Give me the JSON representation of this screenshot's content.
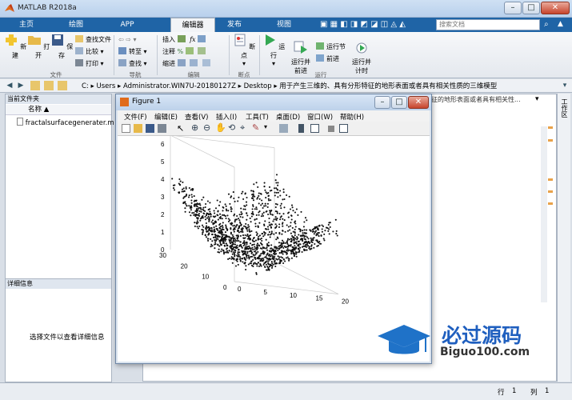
{
  "window": {
    "title": "MATLAB R2018a"
  },
  "tabs": [
    {
      "label": "主页",
      "active": false
    },
    {
      "label": "绘图",
      "active": false
    },
    {
      "label": "APP",
      "active": false
    },
    {
      "label": "编辑器",
      "active": true
    },
    {
      "label": "发布",
      "active": false
    },
    {
      "label": "视图",
      "active": false
    }
  ],
  "search": {
    "placeholder": "搜索文档"
  },
  "ribbon": {
    "file": {
      "new": "新建",
      "open": "打开",
      "save": "保存",
      "find_files": "查找文件",
      "compare": "比较",
      "print": "打印",
      "group": "文件"
    },
    "navigate": {
      "goto": "转至",
      "find": "查找",
      "group": "导航"
    },
    "edit": {
      "insert": "插入",
      "comment": "注释",
      "indent": "缩进",
      "group": "编辑"
    },
    "breakpoints": {
      "label": "断点",
      "group": "断点"
    },
    "run": {
      "run": "运行",
      "run_advance": "运行并\n前进",
      "run_section": "运行节",
      "advance": "前进",
      "run_time": "运行并\n计时",
      "group": "运行"
    }
  },
  "address": {
    "path": [
      "C:",
      "Users",
      "Administrator.WIN7U-20180127Z",
      "Desktop",
      "用于产生三维的、具有分形特征的地形表面或者具有相关性质的三维模型"
    ],
    "right_text": "征的地形表面或者具有相关性..."
  },
  "current_folder": {
    "title": "当前文件夹",
    "column": "名称",
    "files": [
      "fractalsurfacegenerater.m"
    ]
  },
  "details": {
    "title": "详细信息",
    "message": "选择文件以查看详细信息"
  },
  "workspace": {
    "label": "工作区"
  },
  "figure": {
    "title": "Figure 1",
    "menus": [
      "文件(F)",
      "编辑(E)",
      "查看(V)",
      "插入(I)",
      "工具(T)",
      "桌面(D)",
      "窗口(W)",
      "帮助(H)"
    ],
    "z_ticks": [
      "0",
      "1",
      "2",
      "3",
      "4",
      "5",
      "6"
    ],
    "y_ticks": [
      "0",
      "10",
      "20",
      "30"
    ],
    "x_ticks": [
      "0",
      "5",
      "10",
      "15",
      "20"
    ]
  },
  "statusbar": {
    "row_label": "行",
    "row": "1",
    "col_label": "列",
    "col": "1"
  },
  "watermark": {
    "title": "必过源码",
    "url": "Biguo100.com"
  },
  "colors": {
    "tab_bar": "#1f64a6",
    "ribbon": "#eef1f5",
    "point": "#111111"
  }
}
